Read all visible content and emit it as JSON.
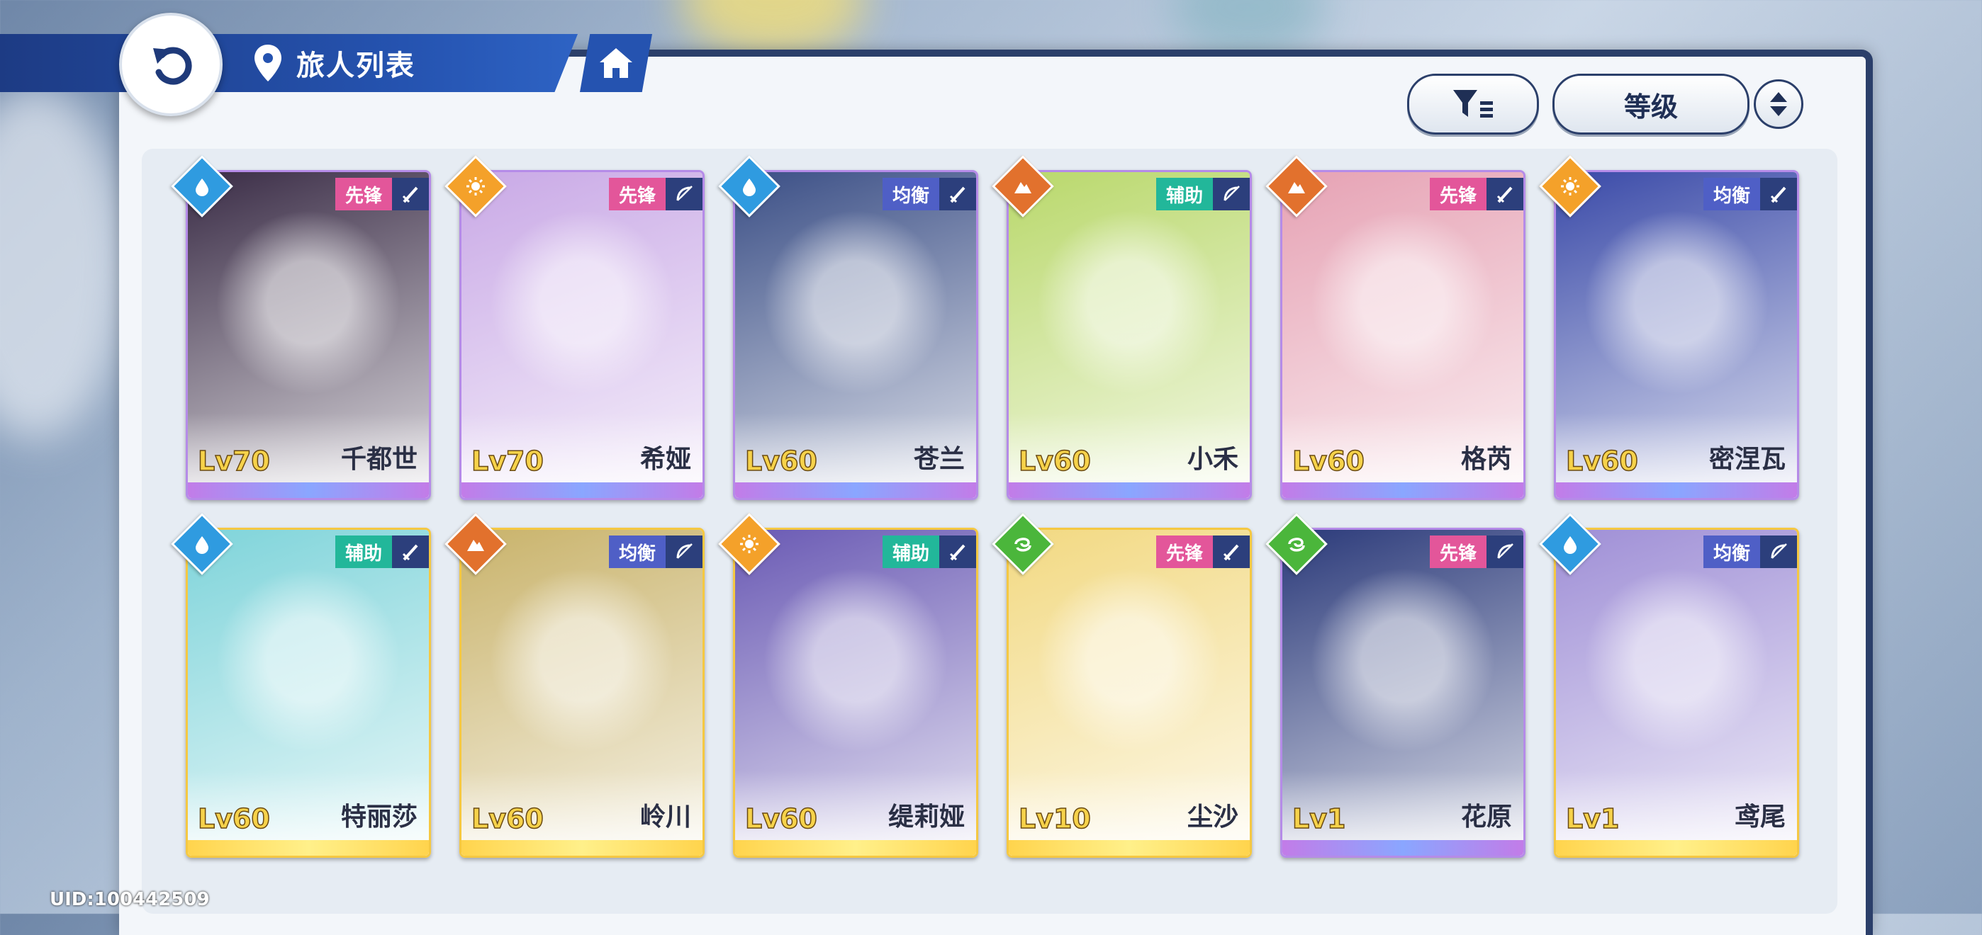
{
  "header": {
    "title": "旅人列表"
  },
  "toolbar": {
    "sort_label": "等级"
  },
  "footer": {
    "uid": "UID:100442509"
  },
  "colors": {
    "water": "#2f9be0",
    "light": "#f4a12a",
    "earth": "#e2712d",
    "wind": "#4bb63b",
    "vanguard": "#e3569a",
    "support": "#22b79a",
    "balance": "#4f5fc6"
  },
  "cards": [
    {
      "name": "千都世",
      "level": "Lv70",
      "role": "先锋",
      "element": "water",
      "weapon": "sword",
      "rarity": "purple",
      "art": "#3a2c46"
    },
    {
      "name": "希娅",
      "level": "Lv70",
      "role": "先锋",
      "element": "light",
      "weapon": "bow",
      "rarity": "purple",
      "art": "#c9a9e6"
    },
    {
      "name": "苍兰",
      "level": "Lv60",
      "role": "均衡",
      "element": "water",
      "weapon": "sword",
      "rarity": "purple",
      "art": "#3b4f86"
    },
    {
      "name": "小禾",
      "level": "Lv60",
      "role": "辅助",
      "element": "earth",
      "weapon": "bow",
      "rarity": "purple",
      "art": "#b9d86b"
    },
    {
      "name": "格芮",
      "level": "Lv60",
      "role": "先锋",
      "element": "earth",
      "weapon": "sword",
      "rarity": "purple",
      "art": "#e6a2b4"
    },
    {
      "name": "密涅瓦",
      "level": "Lv60",
      "role": "均衡",
      "element": "light",
      "weapon": "sword",
      "rarity": "purple",
      "art": "#3a4aa8"
    },
    {
      "name": "特丽莎",
      "level": "Lv60",
      "role": "辅助",
      "element": "water",
      "weapon": "sword",
      "rarity": "gold",
      "art": "#7fd4da"
    },
    {
      "name": "岭川",
      "level": "Lv60",
      "role": "均衡",
      "element": "earth",
      "weapon": "bow",
      "rarity": "gold",
      "art": "#c9b36b"
    },
    {
      "name": "缇莉娅",
      "level": "Lv60",
      "role": "辅助",
      "element": "light",
      "weapon": "sword",
      "rarity": "gold",
      "art": "#6a5ab4"
    },
    {
      "name": "尘沙",
      "level": "Lv10",
      "role": "先锋",
      "element": "wind",
      "weapon": "sword",
      "rarity": "gold",
      "art": "#f2d982"
    },
    {
      "name": "花原",
      "level": "Lv1",
      "role": "先锋",
      "element": "wind",
      "weapon": "bow",
      "rarity": "purple",
      "art": "#2b3a7a"
    },
    {
      "name": "鸢尾",
      "level": "Lv1",
      "role": "均衡",
      "element": "water",
      "weapon": "bow",
      "rarity": "gold",
      "art": "#9f8fd6"
    }
  ]
}
